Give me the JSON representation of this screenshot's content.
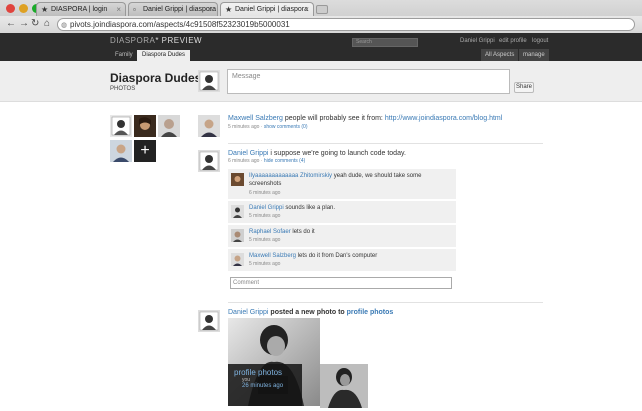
{
  "browser": {
    "tabs": [
      {
        "title": "DIASPORA | login"
      },
      {
        "title": "Daniel Grippi | diaspora"
      },
      {
        "title": "Daniel Grippi | diaspora"
      }
    ],
    "url": "pivots.joindiaspora.com/aspects/4c91508f52323019b5000031"
  },
  "header": {
    "brand_main": "DIASPORA",
    "brand_suffix": "* PREVIEW",
    "search_placeholder": "Search",
    "user_name": "Daniel Grippi",
    "edit_profile": "edit profile",
    "logout": "logout",
    "aspect_tabs": [
      "Family",
      "Diaspora Dudes"
    ],
    "all_aspects": "All Aspects",
    "manage": "manage"
  },
  "aspect": {
    "title": "Diaspora Dudes",
    "subtitle": "PHOTOS",
    "message_placeholder": "Message",
    "share_label": "Share",
    "add_person": "+"
  },
  "posts": [
    {
      "author": "Maxwell Salzberg",
      "text": "people will probably see it from: ",
      "link": "http://www.joindiaspora.com/blog.html",
      "time": "5 minutes ago",
      "sep": " · ",
      "show_comments": "show comments (0)"
    },
    {
      "author": "Daniel Grippi",
      "text": "i suppose we're going to launch code today.",
      "time": "6 minutes ago",
      "sep": " · ",
      "show_comments": "hide comments (4)",
      "comments": [
        {
          "author": "Ilyaaaaaaaaaaaaa Zhitomirskiy",
          "text": "yeah dude, we should take some screenshots",
          "time": "6 minutes ago"
        },
        {
          "author": "Daniel Grippi",
          "text": "sounds like a plan.",
          "time": "5 minutes ago"
        },
        {
          "author": "Raphael Sofaer",
          "text": "lets do it",
          "time": "5 minutes ago"
        },
        {
          "author": "Maxwell Salzberg",
          "text": "lets do it from Dan's computer",
          "time": "5 minutes ago"
        }
      ],
      "comment_placeholder": "Comment"
    },
    {
      "author": "Daniel Grippi",
      "text": " posted a new photo to ",
      "album": "profile photos",
      "photo_caption": "profile photos",
      "photo_by": "you",
      "photo_time": "26 minutes ago"
    }
  ],
  "colors": {
    "link": "#3a7ab5",
    "header_bg": "#2b2b2b",
    "subheader_bg": "#eeeeee"
  }
}
